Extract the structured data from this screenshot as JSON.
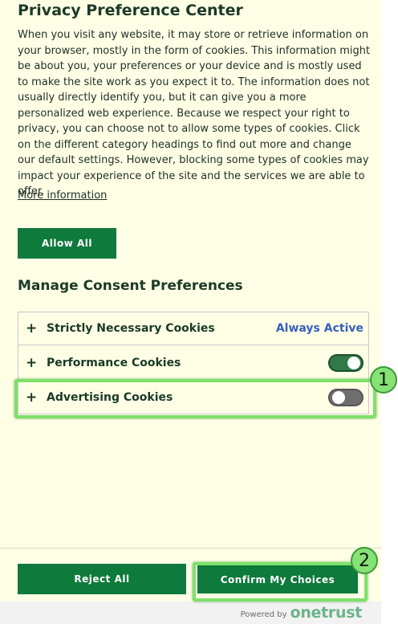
{
  "header": {
    "title": "Privacy Preference Center",
    "description": "When you visit any website, it may store or retrieve information on your browser, mostly in the form of cookies. This information might be about you, your preferences or your device and is mostly used to make the site work as you expect it to. The information does not usually directly identify you, but it can give you a more personalized web experience. Because we respect your right to privacy, you can choose not to allow some types of cookies. Click on the different category headings to find out more and change our default settings. However, blocking some types of cookies may impact your experience of the site and the services we are able to offer.",
    "more_info_label": "More information"
  },
  "allow_all_label": "Allow All",
  "consent": {
    "title": "Manage Consent Preferences",
    "expand_symbol": "+",
    "categories": [
      {
        "label": "Strictly Necessary Cookies",
        "status": "Always Active"
      },
      {
        "label": "Performance Cookies",
        "enabled": true
      },
      {
        "label": "Advertising Cookies",
        "enabled": false
      }
    ]
  },
  "footer": {
    "reject_label": "Reject All",
    "confirm_label": "Confirm My Choices",
    "powered_by": "Powered by",
    "brand": "onetrust"
  },
  "annotations": {
    "badge_1": "1",
    "badge_2": "2",
    "highlight_color": "#7ee06a"
  },
  "colors": {
    "background": "#ffffe6",
    "button": "#0e7a3c",
    "toggle_on": "#2f7a48",
    "toggle_off": "#6e6e6e",
    "always_active": "#3860be"
  }
}
